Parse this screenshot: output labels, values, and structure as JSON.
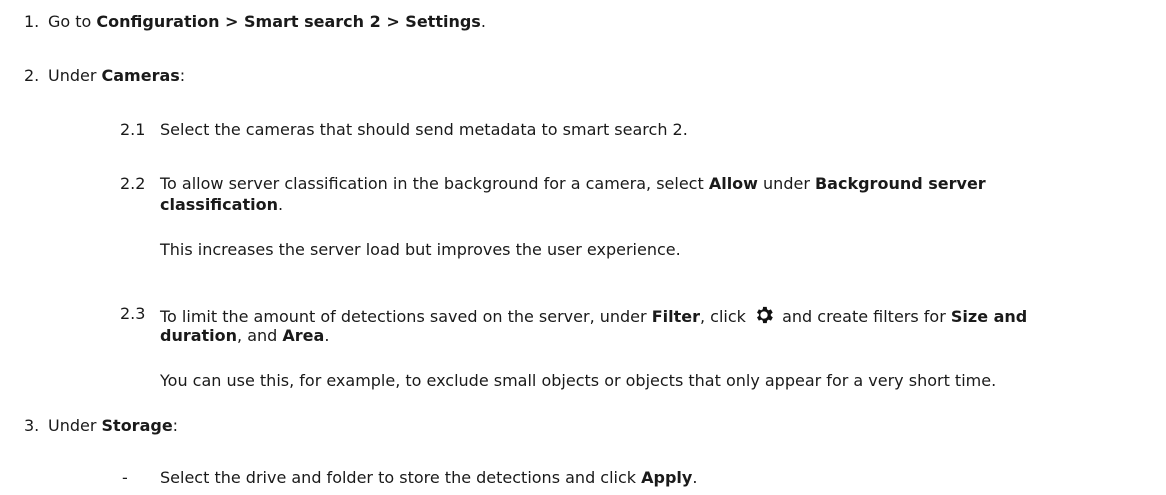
{
  "steps": {
    "s1": {
      "num": "1.",
      "pre": "Go to ",
      "path": "Configuration > Smart search 2 > Settings",
      "post": "."
    },
    "s2": {
      "num": "2.",
      "pre": "Under ",
      "bold": "Cameras",
      "post": ":",
      "sub": {
        "a": {
          "num": "2.1",
          "text": "Select the cameras that should send metadata to smart search 2."
        },
        "b": {
          "num": "2.2",
          "pre": "To allow server classification in the background for a camera, select ",
          "bold1": "Allow",
          "mid": " under ",
          "bold2": "Background server",
          "bold2_cont": "classification",
          "post": ".",
          "note": "This increases the server load but improves the user experience."
        },
        "c": {
          "num": "2.3",
          "pre": "To limit the amount of detections saved on the server, under ",
          "bold1": "Filter",
          "mid": ", click ",
          "icon": "gear-icon",
          "mid2": " and create filters for ",
          "bold2": "Size and",
          "bold2_cont": "duration",
          "mid3": ", and ",
          "bold3": "Area",
          "post": ".",
          "note": "You can use this, for example, to exclude small objects or objects that only appear for a very short time."
        }
      }
    },
    "s3": {
      "num": "3.",
      "pre": "Under ",
      "bold": "Storage",
      "post": ":",
      "sub": {
        "a": {
          "bullet": "-",
          "pre": "Select the drive and folder to store the detections and click ",
          "bold": "Apply",
          "post": "."
        }
      }
    }
  }
}
